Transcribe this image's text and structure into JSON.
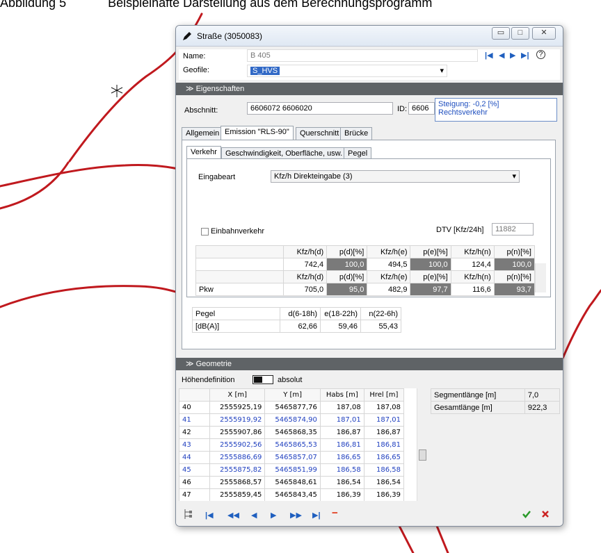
{
  "caption": {
    "figure": "Abbildung 5",
    "text": "Beispielhafte Darstellung aus dem Berechnungsprogramm"
  },
  "window": {
    "title": "Straße (3050083)",
    "buttons": {
      "minimize": "▭",
      "maximize": "□",
      "close": "✕"
    }
  },
  "header": {
    "name_label": "Name:",
    "name_value": "B 405",
    "geofile_label": "Geofile:",
    "geofile_value": "S_HVS",
    "nav": [
      "|◀",
      "◀",
      "▶",
      "▶|",
      "?"
    ]
  },
  "eigenschaften": {
    "title": "Eigenschaften",
    "abschnitt_label": "Abschnitt:",
    "abschnitt_value": "6606072 6606020",
    "id_label": "ID:",
    "id_value": "6606",
    "steigung": "Steigung: -0,2 [%]",
    "verkehr": "Rechtsverkehr"
  },
  "tabs": [
    "Allgemein",
    "Emission \"RLS-90\"",
    "Querschnitt",
    "Brücke"
  ],
  "subtabs": [
    "Verkehr",
    "Geschwindigkeit, Oberfläche, usw.",
    "Pegel"
  ],
  "verkehr": {
    "eingabeart_label": "Eingabeart",
    "eingabeart_value": "Kfz/h Direkteingabe (3)",
    "einbahn_label": "Einbahnverkehr",
    "dtv_label": "DTV [Kfz/24h]",
    "dtv_value": "11882"
  },
  "traffic_table": {
    "headers": [
      "Kfz/h(d)",
      "p(d)[%]",
      "Kfz/h(e)",
      "p(e)[%]",
      "Kfz/h(n)",
      "p(n)[%]"
    ],
    "total_row": [
      "742,4",
      "100,0",
      "494,5",
      "100,0",
      "124,4",
      "100,0"
    ],
    "pkw_label": "Pkw",
    "pkw_row": [
      "705,0",
      "95,0",
      "482,9",
      "97,7",
      "116,6",
      "93,7"
    ]
  },
  "pegel": {
    "label": "Pegel",
    "unit": "[dB(A)]",
    "headers": [
      "d(6-18h)",
      "e(18-22h)",
      "n(22-6h)"
    ],
    "values": [
      "62,66",
      "59,46",
      "55,43"
    ]
  },
  "geometrie": {
    "title": "Geometrie",
    "hoehen_label": "Höhendefinition",
    "hoehen_value": "absolut",
    "headers": [
      "X [m]",
      "Y [m]",
      "Habs [m]",
      "Hrel [m]"
    ],
    "rows": [
      [
        "40",
        "2555925,19",
        "5465877,76",
        "187,08",
        "187,08"
      ],
      [
        "41",
        "2555919,92",
        "5465874,90",
        "187,01",
        "187,01"
      ],
      [
        "42",
        "2555907,86",
        "5465868,35",
        "186,87",
        "186,87"
      ],
      [
        "43",
        "2555902,56",
        "5465865,53",
        "186,81",
        "186,81"
      ],
      [
        "44",
        "2555886,69",
        "5465857,07",
        "186,65",
        "186,65"
      ],
      [
        "45",
        "2555875,82",
        "5465851,99",
        "186,58",
        "186,58"
      ],
      [
        "46",
        "2555868,57",
        "5465848,61",
        "186,54",
        "186,54"
      ],
      [
        "47",
        "2555859,45",
        "5465843,45",
        "186,39",
        "186,39"
      ]
    ],
    "segment_label": "Segmentlänge [m]",
    "segment_value": "7,0",
    "gesamt_label": "Gesamtlänge [m]",
    "gesamt_value": "922,3"
  },
  "bottom_nav": [
    "|◀",
    "◀◀",
    "◀",
    "▶",
    "▶▶",
    "▶|",
    "−"
  ],
  "colors": {
    "accent": "#1f5fbf",
    "section": "#5f6366",
    "road": "#c0191e",
    "ok": "#2a9a2a",
    "cancel": "#cc2222"
  }
}
